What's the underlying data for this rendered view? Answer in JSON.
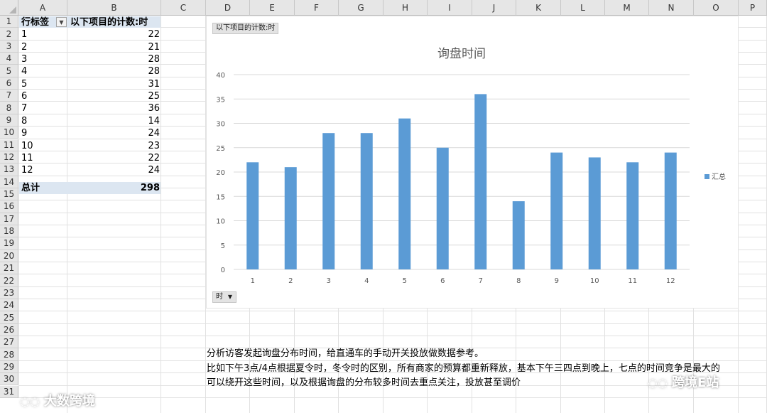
{
  "columns": [
    "A",
    "B",
    "C",
    "D",
    "E",
    "F",
    "G",
    "H",
    "I",
    "J",
    "K",
    "L",
    "M",
    "N",
    "O",
    "P"
  ],
  "rows": [
    "1",
    "2",
    "3",
    "4",
    "5",
    "6",
    "7",
    "8",
    "9",
    "10",
    "11",
    "12",
    "13",
    "14",
    "15",
    "16",
    "17",
    "18",
    "19",
    "20",
    "21",
    "22",
    "23",
    "24",
    "25",
    "26",
    "27",
    "28",
    "29",
    "30",
    "31"
  ],
  "pivot": {
    "header_label": "行标签",
    "header_value": "以下项目的计数:时",
    "items": [
      {
        "label": "1",
        "value": "22"
      },
      {
        "label": "2",
        "value": "21"
      },
      {
        "label": "3",
        "value": "28"
      },
      {
        "label": "4",
        "value": "28"
      },
      {
        "label": "5",
        "value": "31"
      },
      {
        "label": "6",
        "value": "25"
      },
      {
        "label": "7",
        "value": "36"
      },
      {
        "label": "8",
        "value": "14"
      },
      {
        "label": "9",
        "value": "24"
      },
      {
        "label": "10",
        "value": "23"
      },
      {
        "label": "11",
        "value": "22"
      },
      {
        "label": "12",
        "value": "24"
      }
    ],
    "total_label": "总计",
    "total_value": "298"
  },
  "chart_buttons": {
    "value_field": "以下项目的计数:时",
    "axis_field": "时"
  },
  "chart_data": {
    "type": "bar",
    "title": "询盘时间",
    "categories": [
      "1",
      "2",
      "3",
      "4",
      "5",
      "6",
      "7",
      "8",
      "9",
      "10",
      "11",
      "12"
    ],
    "series": [
      {
        "name": "汇总",
        "values": [
          22,
          21,
          28,
          28,
          31,
          25,
          36,
          14,
          24,
          23,
          22,
          24
        ],
        "color": "#5b9bd5"
      }
    ],
    "ylim": [
      0,
      40
    ],
    "yticks": [
      0,
      5,
      10,
      15,
      20,
      25,
      30,
      35,
      40
    ],
    "grid": true,
    "legend": "right"
  },
  "notes": [
    "分析访客发起询盘分布时间，给直通车的手动开关投放做数据参考。",
    "比如下午3点/4点根据夏令时，冬令时的区别，所有商家的预算都重新释放，基本下午三四点到晚上，七点的时间竞争是最大的",
    "可以绕开这些时间，以及根据询盘的分布较多时间去重点关注，投放甚至调价"
  ],
  "watermarks": {
    "left": "大数跨境",
    "right": "跨境E站"
  }
}
